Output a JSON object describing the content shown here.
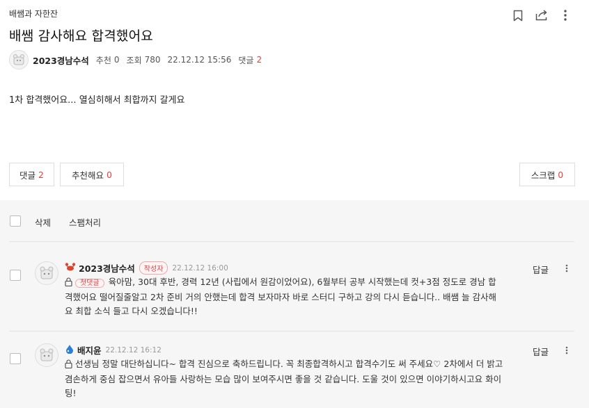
{
  "post": {
    "board": "배쌤과 자한잔",
    "title": "배쌤 감사해요 합격했어요",
    "author": "2023경남수석",
    "recommend_label": "추천",
    "recommend_count": "0",
    "views_label": "조회",
    "views_count": "780",
    "datetime": "22.12.12 15:56",
    "comments_label": "댓글",
    "comments_count": "2",
    "body": "1차 합격했어요... 열심히해서 최합까지 갈게요"
  },
  "actions": {
    "comments_label": "댓글",
    "comments_count": "2",
    "recommend_label": "추천해요",
    "recommend_count": "0",
    "scrap_label": "스크랩",
    "scrap_count": "0"
  },
  "toolbar": {
    "delete": "삭제",
    "spam": "스팸처리"
  },
  "comments": [
    {
      "author": "2023경남수석",
      "badge": "작성자",
      "date": "22.12.12 16:00",
      "tag": "첫댓글",
      "text": "육아맘, 30대 후반, 경력 12년 (사립에서 원감이었어요), 6월부터 공부 시작했는데 컷+3점 정도로 경남 합격했어요 떨어질줄알고 2차 준비 거의 안했는데 합격 보자마자 바로 스터디 구하고 강의 다시 듣습니다.. 배쌤 늘 감사해요 최합 소식 들고 다시 오겠습니다!!",
      "reply": "답글"
    },
    {
      "author": "배지윤",
      "date": "22.12.12 16:12",
      "text": "선생님 정말 대단하십니다~ 합격 진심으로 축하드립니다. 꼭 최종합격하시고 합격수기도 써 주세요♡ 2차에서 더 밝고 겸손하게 중심 잡으면서 유아들 사랑하는 모습 많이 보여주시면 좋을 것 같습니다. 도울 것이 있으면 이야기하시고요 화이팅!",
      "reply": "답글"
    }
  ],
  "icons": {
    "bookmark": "bookmark-icon",
    "share": "share-icon",
    "more": "more-vertical-icon",
    "lock": "lock-icon",
    "crab": "crab-icon",
    "drop": "blue-drop-icon"
  },
  "colors": {
    "accent_red": "#e54040",
    "gray_bg": "#f6f6f6",
    "border": "#dddddd"
  }
}
